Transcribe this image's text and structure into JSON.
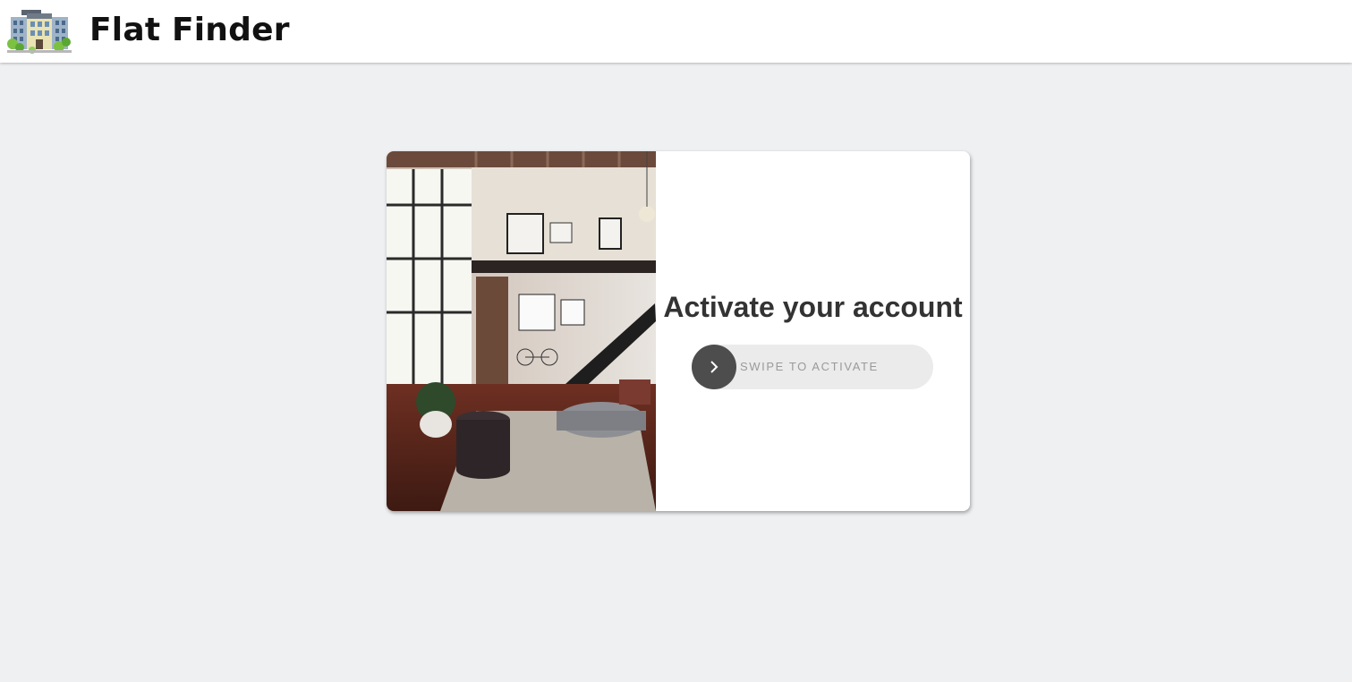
{
  "header": {
    "logo_icon": "apartment-building-logo-icon",
    "title": "Flat Finder"
  },
  "card": {
    "image_icon": "loft-interior-photo",
    "heading": "Activate your account",
    "swipe": {
      "label": "SWIPE TO ACTIVATE",
      "handle_icon": "chevron-right-icon"
    }
  },
  "colors": {
    "background": "#eff0f2",
    "header_bg": "#ffffff",
    "handle": "#4d4d4d",
    "track": "#ebebeb",
    "heading_text": "#333333"
  }
}
